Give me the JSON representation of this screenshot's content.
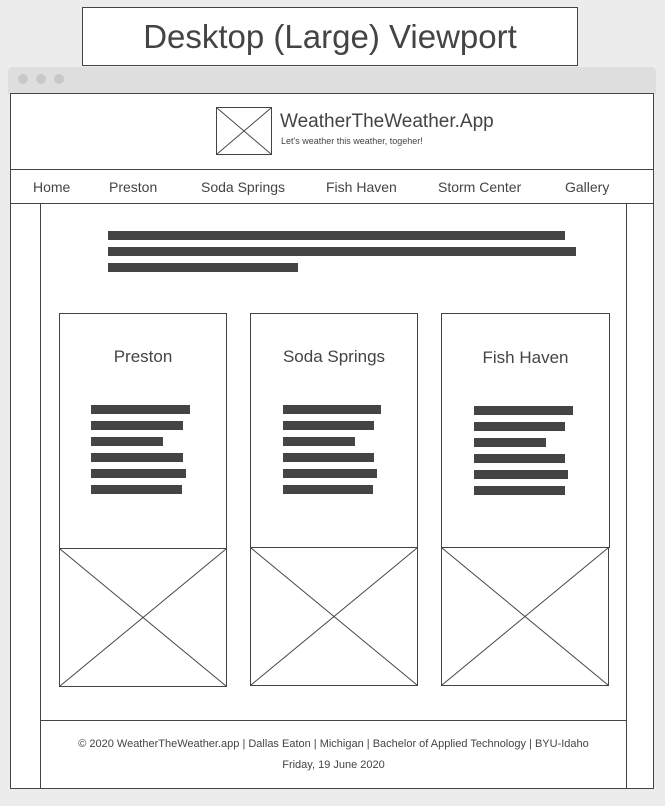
{
  "viewport_label": "Desktop (Large) Viewport",
  "header": {
    "site_title": "WeatherTheWeather.App",
    "tagline": "Let's weather this weather, togeher!",
    "logo_icon": "image-placeholder-icon"
  },
  "nav": {
    "items": [
      {
        "label": "Home"
      },
      {
        "label": "Preston"
      },
      {
        "label": "Soda Springs"
      },
      {
        "label": "Fish Haven"
      },
      {
        "label": "Storm Center"
      },
      {
        "label": "Gallery"
      }
    ]
  },
  "cards": [
    {
      "title": "Preston",
      "image_icon": "image-placeholder-icon"
    },
    {
      "title": "Soda Springs",
      "image_icon": "image-placeholder-icon"
    },
    {
      "title": "Fish Haven",
      "image_icon": "image-placeholder-icon"
    }
  ],
  "footer": {
    "line1": "© 2020 WeatherTheWeather.app | Dallas Eaton | Michigan | Bachelor of Applied Technology | BYU-Idaho",
    "line2": "Friday, 19 June 2020"
  }
}
